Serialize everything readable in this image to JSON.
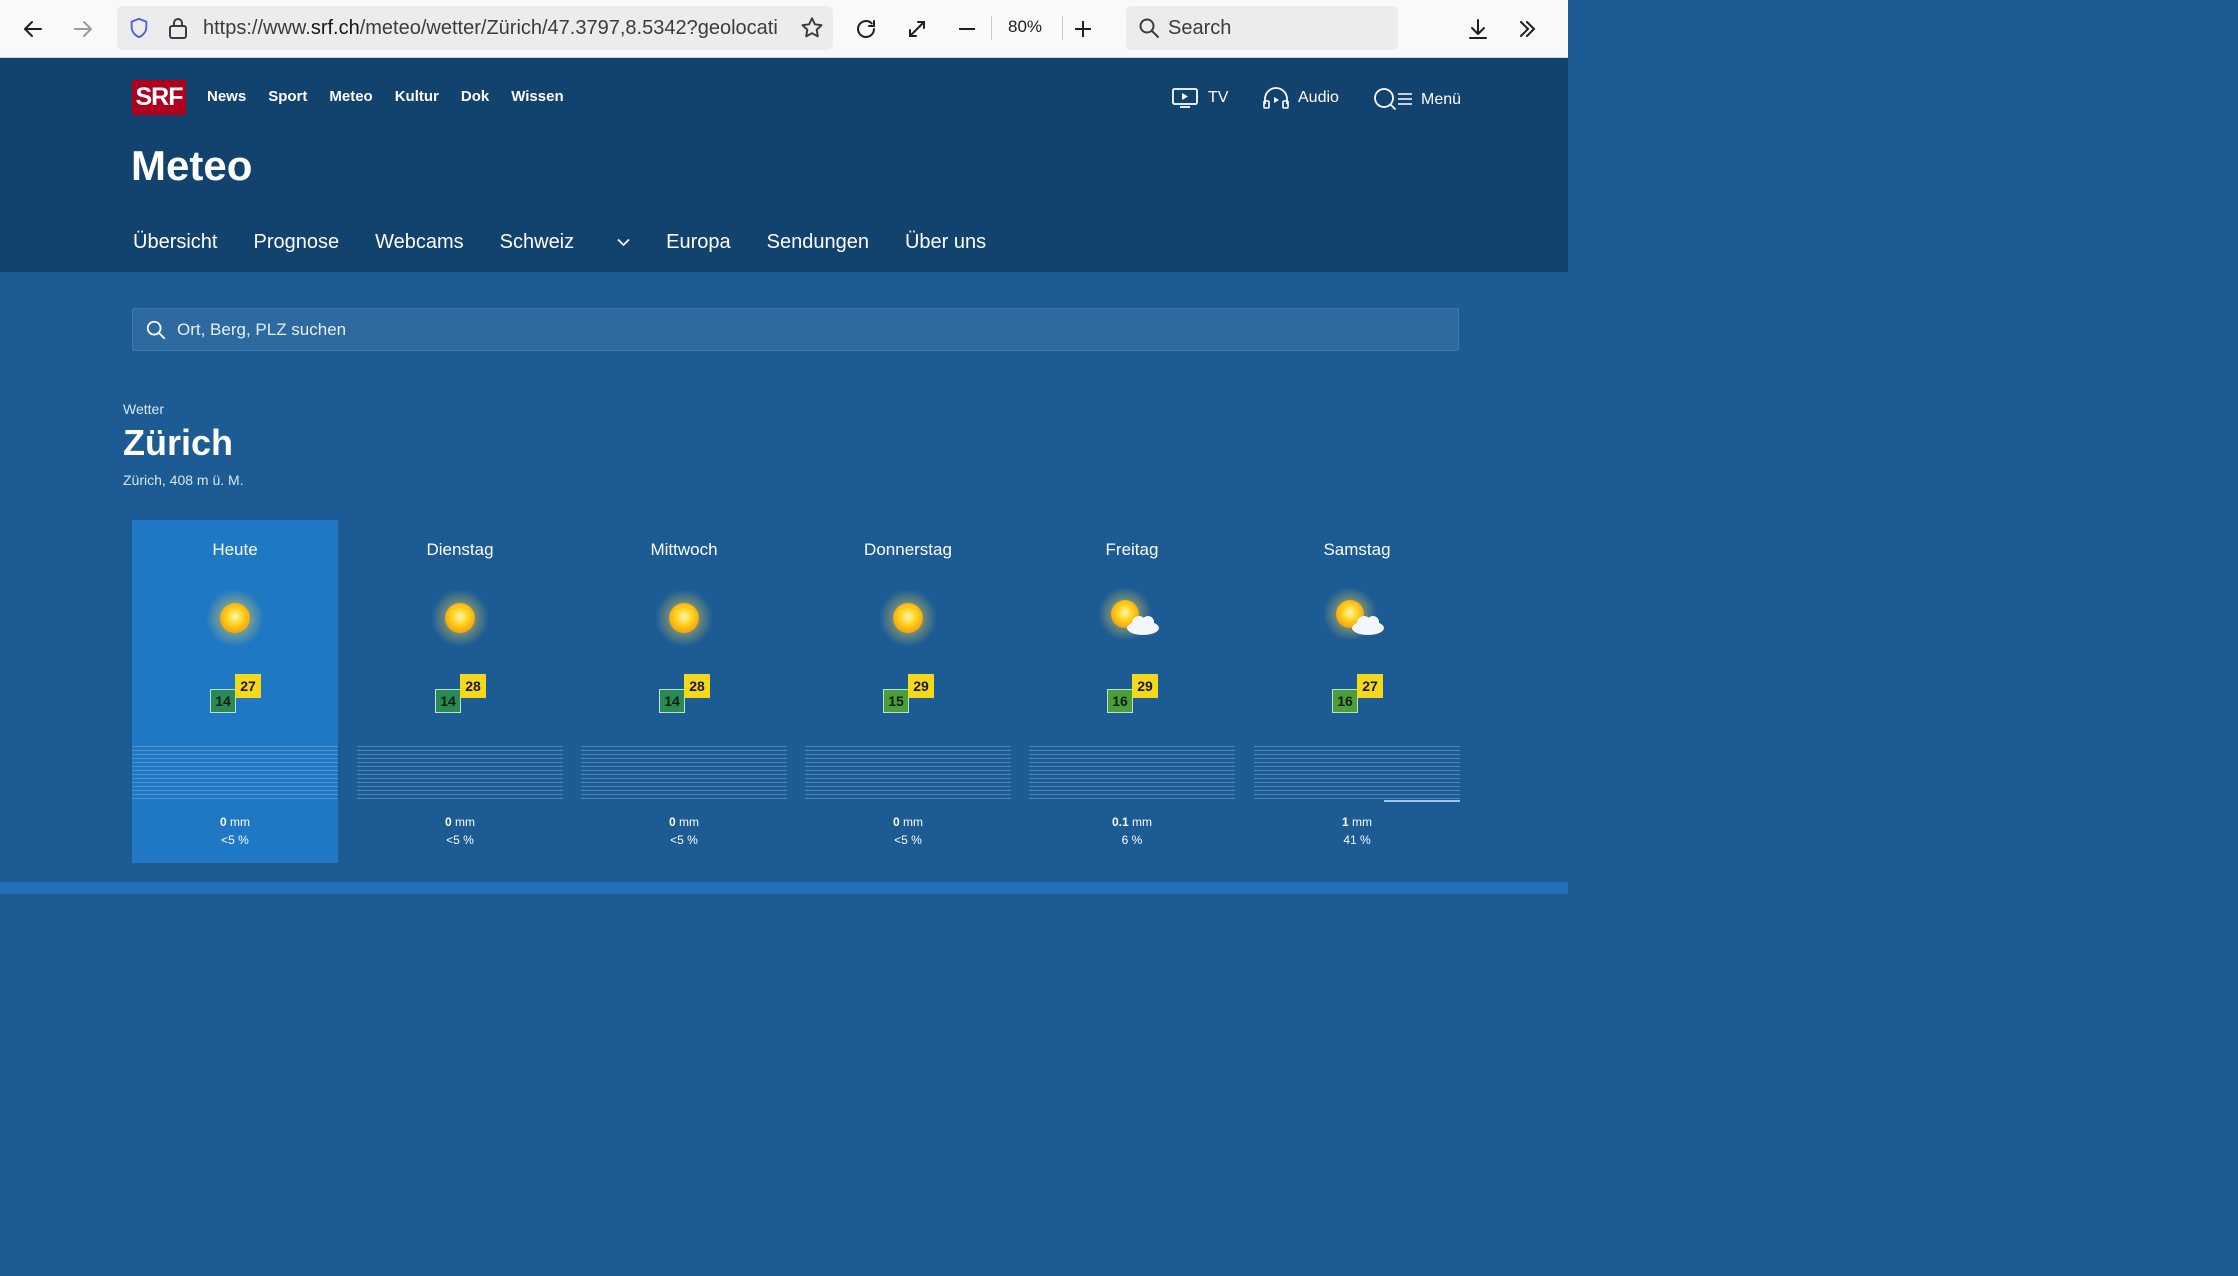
{
  "browser": {
    "url_prefix": "https://www.",
    "url_domain": "srf.ch",
    "url_path": "/meteo/wetter/Zürich/47.3797,8.5342?geolocati",
    "zoom": "80%",
    "search_placeholder": "Search"
  },
  "header": {
    "logo": "SRF",
    "topnav": [
      "News",
      "Sport",
      "Meteo",
      "Kultur",
      "Dok",
      "Wissen"
    ],
    "tv_label": "TV",
    "audio_label": "Audio",
    "menu_label": "Menü",
    "title": "Meteo",
    "subnav": [
      "Übersicht",
      "Prognose",
      "Webcams",
      "Schweiz",
      "Europa",
      "Sendungen",
      "Über uns"
    ]
  },
  "search": {
    "placeholder": "Ort, Berg, PLZ suchen"
  },
  "location": {
    "label": "Wetter",
    "city": "Zürich",
    "details": "Zürich, 408 m ü. M."
  },
  "forecast": [
    {
      "day": "Heute",
      "icon": "sun-icon",
      "min": "14",
      "max": "27",
      "precip_value": "0",
      "precip_unit": "mm",
      "prob": "<5 %",
      "active": true
    },
    {
      "day": "Dienstag",
      "icon": "sun-icon",
      "min": "14",
      "max": "28",
      "precip_value": "0",
      "precip_unit": "mm",
      "prob": "<5 %",
      "active": false
    },
    {
      "day": "Mittwoch",
      "icon": "sun-icon",
      "min": "14",
      "max": "28",
      "precip_value": "0",
      "precip_unit": "mm",
      "prob": "<5 %",
      "active": false
    },
    {
      "day": "Donnerstag",
      "icon": "sun-icon",
      "min": "15",
      "max": "29",
      "precip_value": "0",
      "precip_unit": "mm",
      "prob": "<5 %",
      "active": false
    },
    {
      "day": "Freitag",
      "icon": "sun-cloud-icon",
      "min": "16",
      "max": "29",
      "precip_value": "0.1",
      "precip_unit": "mm",
      "prob": "6 %",
      "active": false
    },
    {
      "day": "Samstag",
      "icon": "sun-cloud-icon",
      "min": "16",
      "max": "27",
      "precip_value": "1",
      "precip_unit": "mm",
      "prob": "41 %",
      "active": false
    }
  ]
}
